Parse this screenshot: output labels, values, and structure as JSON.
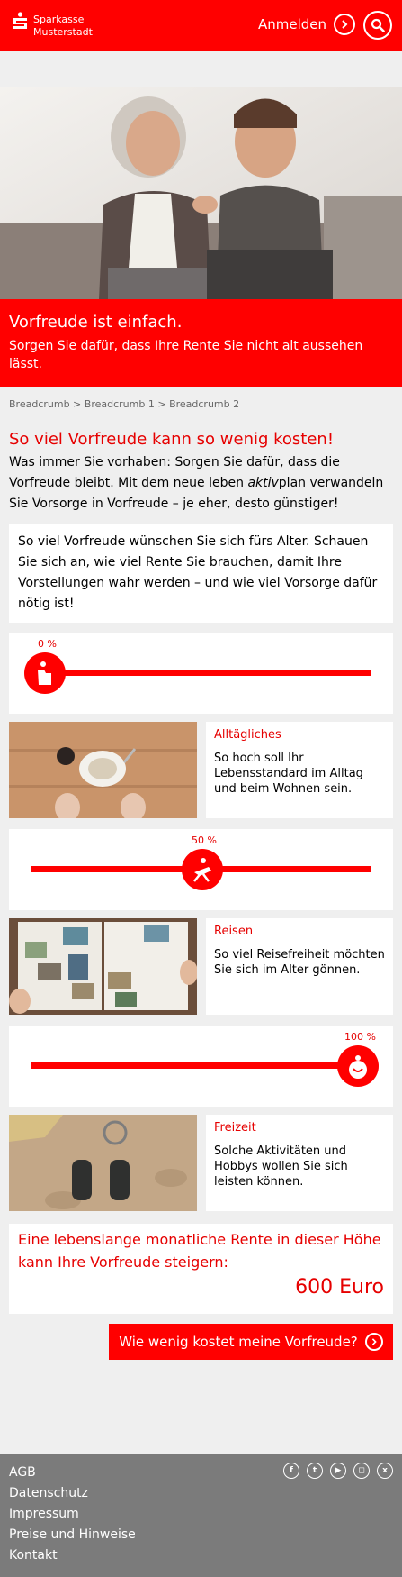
{
  "header": {
    "brand_line1": "Sparkasse",
    "brand_line2": "Musterstadt",
    "login_label": "Anmelden"
  },
  "hero": {
    "title": "Vorfreude ist einfach.",
    "subtitle": "Sorgen Sie dafür, dass Ihre Rente Sie nicht alt aussehen lässt."
  },
  "breadcrumb": [
    "Breadcrumb",
    "Breadcrumb 1",
    "Breadcrumb 2"
  ],
  "breadcrumb_sep": " > ",
  "intro": {
    "title": "So viel Vorfreude kann so wenig kosten!",
    "text_part1": "Was immer Sie vorhaben: Sorgen Sie dafür, dass die Vorfreude bleibt. Mit dem neue leben ",
    "text_emph": "aktiv",
    "text_part2": "plan verwandeln Sie Vorsorge in Vorfreude – je eher, desto günstiger!"
  },
  "info_card": {
    "text": "So viel Vorfreude wünschen Sie sich fürs Alter. Schauen Sie sich an, wie viel Rente Sie brauchen, damit Ihre Vorstellungen wahr werden – und wie viel Vorsorge dafür nötig ist!"
  },
  "sliders": [
    {
      "value_label": "0 %",
      "value": 0,
      "icon": "home-icon"
    },
    {
      "value_label": "50 %",
      "value": 50,
      "icon": "deck-chair-icon"
    },
    {
      "value_label": "100 %",
      "value": 100,
      "icon": "smiley-icon"
    }
  ],
  "tiles": [
    {
      "title": "Alltägliches",
      "text": "So hoch soll Ihr Lebensstandard im Alltag und beim Wohnen sein."
    },
    {
      "title": "Reisen",
      "text": "So viel Reisefreiheit möchten Sie sich im Alter gönnen."
    },
    {
      "title": "Freizeit",
      "text": "Solche Aktivitäten und Hobbys wollen Sie sich leisten können."
    }
  ],
  "result": {
    "text": "Eine lebenslange monatliche Rente in dieser Höhe kann Ihre Vorfreude steigern:",
    "value": "600 Euro"
  },
  "cta_label": "Wie wenig kostet meine Vorfreude?",
  "footer": {
    "links": [
      "AGB",
      "Datenschutz",
      "Impressum",
      "Preise und Hinweise",
      "Kontakt"
    ],
    "social": [
      {
        "name": "facebook-icon",
        "glyph": "f"
      },
      {
        "name": "twitter-icon",
        "glyph": "t"
      },
      {
        "name": "youtube-icon",
        "glyph": "▶"
      },
      {
        "name": "instagram-icon",
        "glyph": "◻"
      },
      {
        "name": "xing-icon",
        "glyph": "x"
      }
    ]
  },
  "colors": {
    "brand": "#ff0000",
    "footer": "#7b7b7b",
    "background": "#efefef"
  }
}
